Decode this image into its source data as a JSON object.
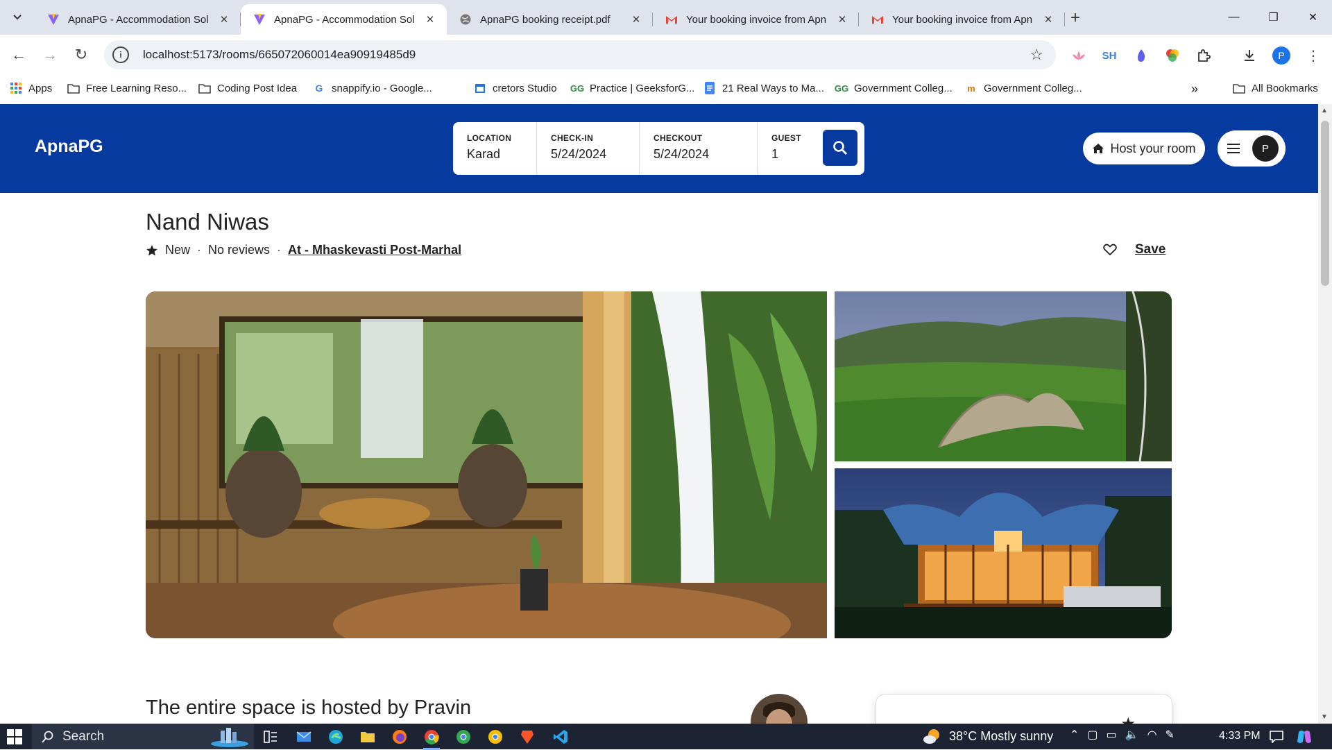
{
  "browser": {
    "tabs": [
      {
        "title": "ApnaPG - Accommodation Solu",
        "icon": "vite-icon",
        "active": false
      },
      {
        "title": "ApnaPG - Accommodation Solu",
        "icon": "vite-icon",
        "active": true
      },
      {
        "title": "ApnaPG booking receipt.pdf",
        "icon": "globe-icon",
        "active": false
      },
      {
        "title": "Your booking invoice from Apn",
        "icon": "gmail-icon",
        "active": false
      },
      {
        "title": "Your booking invoice from Apn",
        "icon": "gmail-icon",
        "active": false
      }
    ],
    "url": "localhost:5173/rooms/665072060014ea90919485d9",
    "extensions": {
      "sh_label": "SH",
      "profile_initial": "P"
    },
    "bookmarks": [
      {
        "label": "Apps",
        "icon": "apps-grid-icon"
      },
      {
        "label": "Free Learning Reso...",
        "icon": "folder-icon"
      },
      {
        "label": "Coding Post Idea",
        "icon": "folder-icon"
      },
      {
        "label": "snappify.io - Google...",
        "icon": "google-icon"
      },
      {
        "label": "cretors Studio",
        "icon": "calendar-icon"
      },
      {
        "label": "Practice | GeeksforG...",
        "icon": "gfg-icon"
      },
      {
        "label": "21 Real Ways to Ma...",
        "icon": "docs-icon"
      },
      {
        "label": "Government Colleg...",
        "icon": "gfg-icon"
      },
      {
        "label": "Government Colleg...",
        "icon": "mn-icon"
      }
    ],
    "all_bookmarks": "All Bookmarks"
  },
  "header": {
    "logo": "ApnaPG",
    "search": {
      "location_label": "LOCATION",
      "location_value": "Karad",
      "checkin_label": "CHECK-IN",
      "checkin_value": "5/24/2024",
      "checkout_label": "CHECKOUT",
      "checkout_value": "5/24/2024",
      "guest_label": "GUEST",
      "guest_value": "1"
    },
    "host_button": "Host your room",
    "user_initial": "P"
  },
  "room": {
    "title": "Nand Niwas",
    "badge": "New",
    "reviews": "No reviews",
    "address": "At - Mhaskevasti Post-Marhal",
    "save_label": "Save",
    "hosted_by": "The entire space is hosted by Pravin"
  },
  "taskbar": {
    "search_label": "Search",
    "weather": "38°C  Mostly sunny",
    "time": "4:33 PM"
  },
  "colors": {
    "brand": "#063a9e",
    "chrome": "#dfe3eb",
    "taskbar": "#1c2433"
  }
}
